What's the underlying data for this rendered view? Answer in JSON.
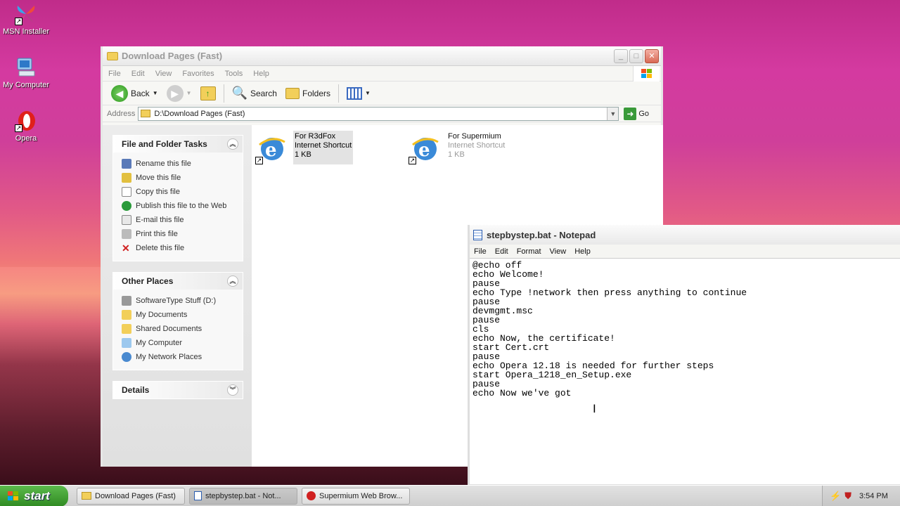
{
  "desktop": {
    "icons": [
      {
        "label": "MSN Installer"
      },
      {
        "label": "My Computer"
      },
      {
        "label": "Opera"
      }
    ]
  },
  "explorer": {
    "title": "Download Pages (Fast)",
    "menu": [
      "File",
      "Edit",
      "View",
      "Favorites",
      "Tools",
      "Help"
    ],
    "toolbar": {
      "back": "Back",
      "search": "Search",
      "folders": "Folders"
    },
    "address_label": "Address",
    "address_value": "D:\\Download Pages (Fast)",
    "go_label": "Go",
    "tasks_panel": {
      "title": "File and Folder Tasks",
      "items": [
        "Rename this file",
        "Move this file",
        "Copy this file",
        "Publish this file to the Web",
        "E-mail this file",
        "Print this file",
        "Delete this file"
      ]
    },
    "places_panel": {
      "title": "Other Places",
      "items": [
        "SoftwareType Stuff (D:)",
        "My Documents",
        "Shared Documents",
        "My Computer",
        "My Network Places"
      ]
    },
    "details_panel": {
      "title": "Details"
    },
    "files": [
      {
        "name": "For R3dFox",
        "type": "Internet Shortcut",
        "size": "1 KB"
      },
      {
        "name": "For Supermium",
        "type": "Internet Shortcut",
        "size": "1 KB"
      }
    ]
  },
  "notepad": {
    "title": "stepbystep.bat - Notepad",
    "menu": [
      "File",
      "Edit",
      "Format",
      "View",
      "Help"
    ],
    "lines": [
      "@echo off",
      "echo Welcome!",
      "pause",
      "echo Type !network then press anything to continue",
      "pause",
      "devmgmt.msc",
      "pause",
      "cls",
      "echo Now, the certificate!",
      "start Cert.crt",
      "pause",
      "echo Opera 12.18 is needed for further steps",
      "start Opera_1218_en_Setup.exe",
      "pause",
      "echo Now we've got"
    ]
  },
  "taskbar": {
    "start_label": "start",
    "buttons": [
      "Download Pages (Fast)",
      "stepbystep.bat - Not...",
      "Supermium Web Brow..."
    ],
    "clock": "3:54 PM"
  },
  "colors": {
    "start_green": "#3a9a2a",
    "close_red": "#d96a56",
    "link_blue": "#2a5db0"
  }
}
